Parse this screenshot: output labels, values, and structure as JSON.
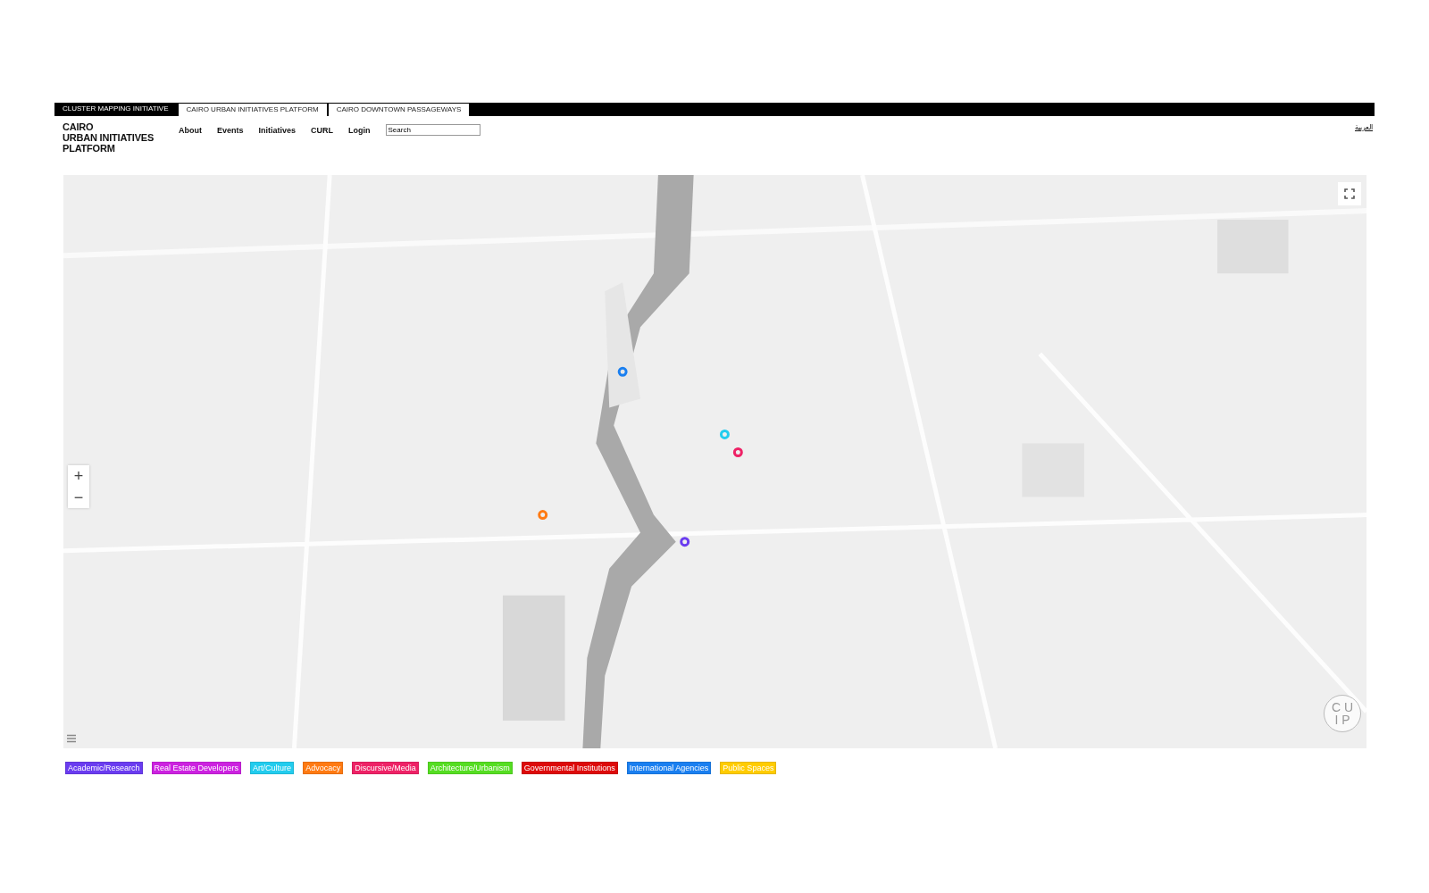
{
  "top_bar": {
    "tabs": [
      {
        "label": "CLUSTER MAPPING INITIATIVE",
        "kind": "label"
      },
      {
        "label": "CAIRO URBAN INITIATIVES PLATFORM",
        "kind": "tab"
      },
      {
        "label": "CAIRO DOWNTOWN PASSAGEWAYS",
        "kind": "tab"
      }
    ]
  },
  "header": {
    "logo_lines": [
      "CAIRO",
      "URBAN INITIATIVES",
      "PLATFORM"
    ],
    "nav": [
      "About",
      "Events",
      "Initiatives",
      "CURL",
      "Login"
    ],
    "search": {
      "value": "Search"
    },
    "language_link": "العربية"
  },
  "map": {
    "kind": "picture",
    "zoom_in": "+",
    "zoom_out": "−",
    "badge_lines": [
      "CU",
      "IP"
    ]
  },
  "legend": [
    {
      "label": "Academic/Research",
      "color": "#6a3cf0"
    },
    {
      "label": "Real Estate Developers",
      "color": "#cc22e0"
    },
    {
      "label": "Art/Culture",
      "color": "#22ccee"
    },
    {
      "label": "Advocacy",
      "color": "#ff7a12"
    },
    {
      "label": "Discursive/Media",
      "color": "#ee2266"
    },
    {
      "label": "Architecture/Urbanism",
      "color": "#55dd22"
    },
    {
      "label": "Governmental Institutions",
      "color": "#dd0a0a"
    },
    {
      "label": "International Agencies",
      "color": "#1a7ff0"
    },
    {
      "label": "Public Spaces",
      "color": "#ffcc00"
    }
  ]
}
